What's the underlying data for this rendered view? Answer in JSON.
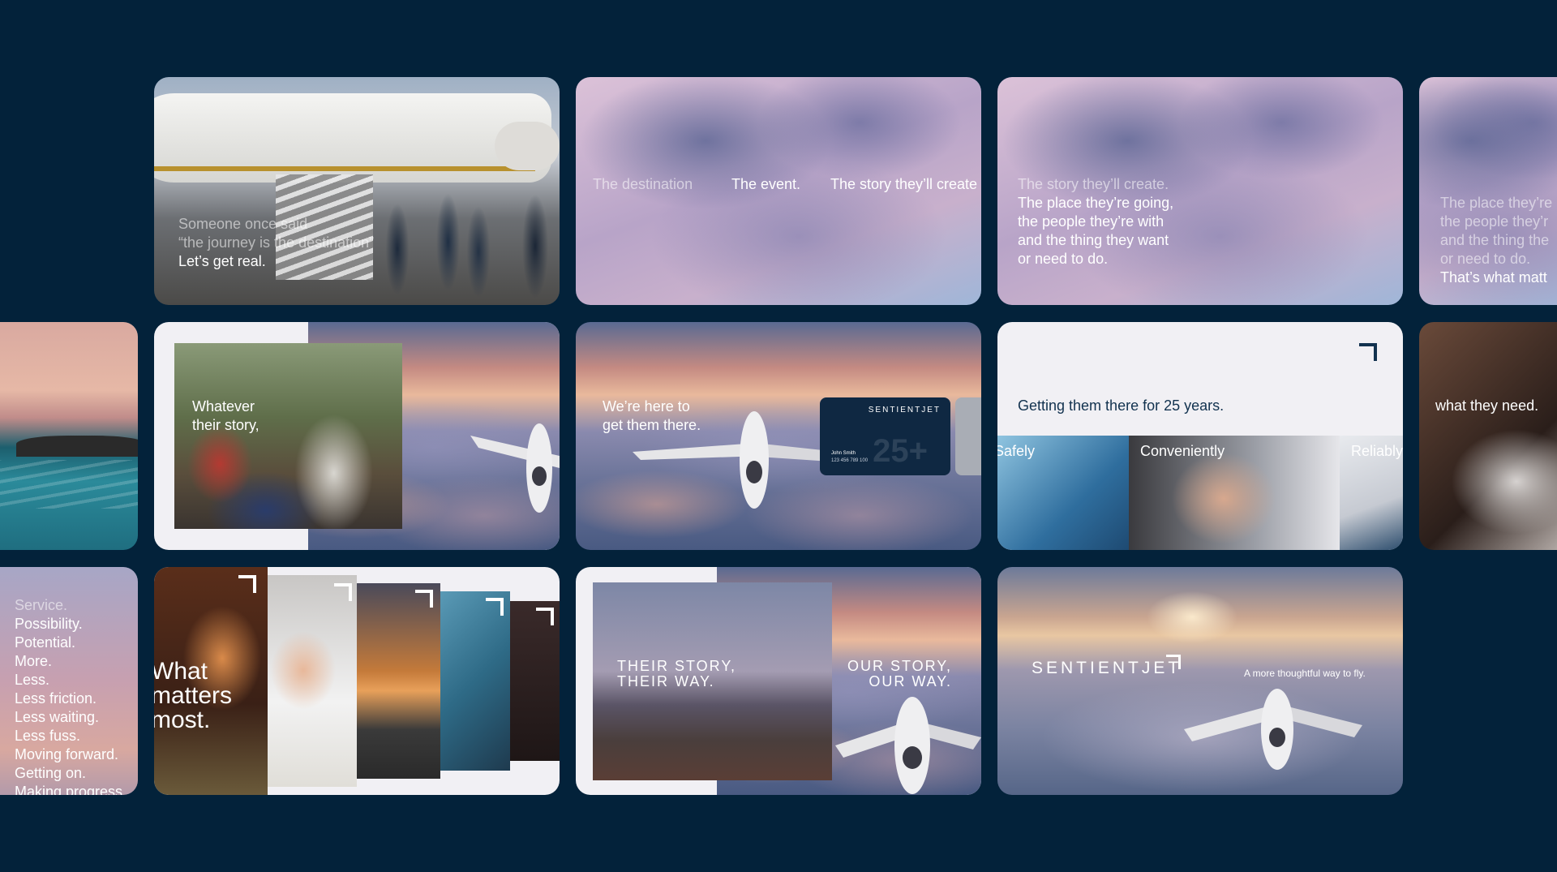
{
  "colors": {
    "background": "#03223a",
    "navy": "#12324f",
    "panel": "#f1f0f4"
  },
  "row1": {
    "tile1": {
      "lines_dim": [
        "Someone once said",
        "“the journey is the destination”"
      ],
      "line_bright": "Let’s get real."
    },
    "tile2": {
      "word1": "The destination",
      "word2": "The event.",
      "word3": "The story they’ll create"
    },
    "tile3": {
      "line_dim": "The story they’ll create.",
      "lines": [
        "The place they’re going,",
        "the people they’re with",
        "and the thing they want",
        "or need to do."
      ]
    },
    "tile4": {
      "lines_dim": [
        "The place they’re",
        "the people they’r",
        "and the thing the",
        "or need to do."
      ],
      "line_bright": "That’s what matt"
    }
  },
  "row2": {
    "tile2": {
      "lines": [
        "Whatever",
        "their story,"
      ]
    },
    "tile3": {
      "lines": [
        "We’re here to",
        "get them there."
      ],
      "card": {
        "brand": "SENTIENTJET",
        "holder": "John Smith",
        "number": "123 456 789 100",
        "big_text": "25+"
      }
    },
    "tile4": {
      "headline": "Getting them there for 25 years.",
      "panels": [
        "Safely",
        "Conveniently",
        "Reliably"
      ]
    },
    "tile5": {
      "text": "what they need."
    }
  },
  "row3": {
    "tile0": {
      "lines_dim": [
        "Service."
      ],
      "lines": [
        "Possibility.",
        "Potential.",
        "More.",
        "Less.",
        "Less friction.",
        "Less waiting.",
        "Less fuss.",
        "Moving forward.",
        "Getting on.",
        "Making progress"
      ]
    },
    "tile1": {
      "lines": [
        "What",
        "matters",
        "most."
      ]
    },
    "tile2": {
      "left": [
        "THEIR STORY,",
        "THEIR WAY."
      ],
      "right": [
        "OUR STORY,",
        "OUR WAY."
      ]
    },
    "tile3": {
      "brand": "SENTIENTJET",
      "tagline": "A more thoughtful way to fly."
    }
  }
}
